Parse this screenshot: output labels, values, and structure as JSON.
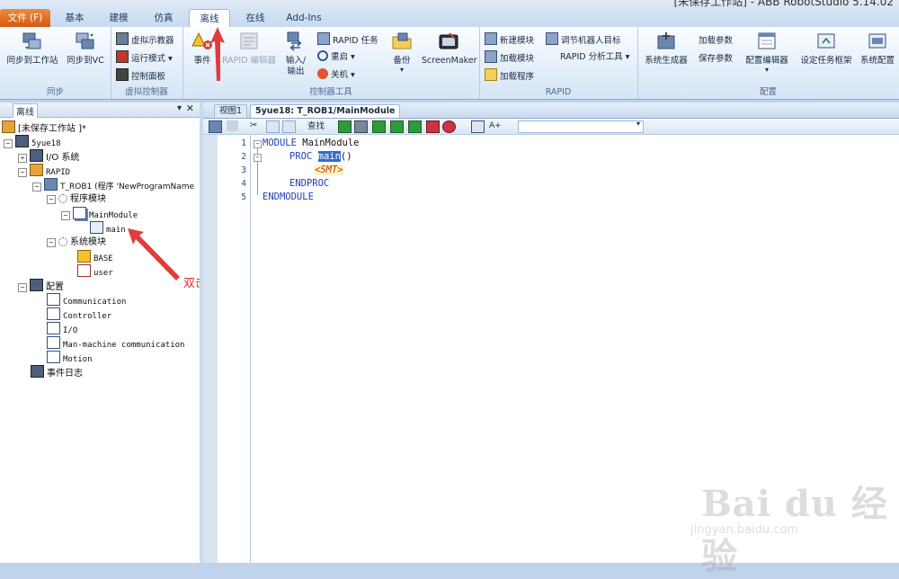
{
  "window": {
    "title": "[未保存工作站] - ABB RobotStudio 5.14.02"
  },
  "tabs": [
    {
      "label": "文件 (F)"
    },
    {
      "label": "基本"
    },
    {
      "label": "建模"
    },
    {
      "label": "仿真"
    },
    {
      "label": "离线"
    },
    {
      "label": "在线"
    },
    {
      "label": "Add-Ins"
    }
  ],
  "ribbon": {
    "sync": {
      "label": "同步",
      "to_station": "同步到工作站",
      "to_vc": "同步到VC"
    },
    "vc": {
      "label": "虚拟控制器",
      "flexpendant": "虚拟示教器",
      "run_mode": "运行模式",
      "control_panel": "控制面板"
    },
    "tools": {
      "label": "控制器工具",
      "events": "事件",
      "rapid_editor": "RAPID 编辑器",
      "io": "输入/\n输出",
      "rapid_tasks": "RAPID 任务",
      "restart": "重启",
      "shutdown": "关机",
      "backup": "备份",
      "screenmaker": "ScreenMaker"
    },
    "rapid": {
      "label": "RAPID",
      "new_module": "新建模块",
      "load_module": "加载模块",
      "load_program": "加载程序",
      "adjust_targets": "调节机器人目标",
      "rapid_analysis": "RAPID 分析工具"
    },
    "config": {
      "label": "配置",
      "system_builder": "系统生成器",
      "load_params": "加载参数",
      "save_params": "保存参数",
      "config_editor": "配置编辑器",
      "task_frame": "设定任务框架",
      "system_config": "系统配置"
    }
  },
  "left_panel": {
    "title": "离线",
    "tree": [
      {
        "label": "[未保存工作站 ]*"
      },
      {
        "label": "5yue18"
      },
      {
        "label": "I/O 系统"
      },
      {
        "label": "RAPID"
      },
      {
        "label": "T_ROB1 (程序 'NewProgramName"
      },
      {
        "label": "程序模块"
      },
      {
        "label": "MainModule"
      },
      {
        "label": "main"
      },
      {
        "label": "系统模块"
      },
      {
        "label": "BASE"
      },
      {
        "label": "user"
      },
      {
        "label": "配置"
      },
      {
        "label": "Communication"
      },
      {
        "label": "Controller"
      },
      {
        "label": "I/O"
      },
      {
        "label": "Man-machine communication"
      },
      {
        "label": "Motion"
      },
      {
        "label": "事件日志"
      }
    ]
  },
  "editor": {
    "tabs": [
      {
        "label": "视图1"
      },
      {
        "label": "5yue18: T_ROB1/MainModule"
      }
    ],
    "find_label": "查找",
    "lines": [
      {
        "num": "1",
        "kw": "MODULE",
        "rest": " MainModule"
      },
      {
        "num": "2",
        "kw": "PROC",
        "sel": "main",
        "rest": "()"
      },
      {
        "num": "3",
        "smt": "<SMT>"
      },
      {
        "num": "4",
        "kw": "ENDPROC"
      },
      {
        "num": "5",
        "kw": "ENDMODULE"
      }
    ]
  },
  "annotation": {
    "text": "双击"
  },
  "watermark": {
    "brand": "Bai du 经验",
    "url": "jingyan.baidu.com"
  },
  "colors": {
    "accent": "#d45a10",
    "keyword": "#1f3fb8",
    "selection": "#2f6fd0",
    "smt": "#c0390a",
    "annotation": "#e03030"
  }
}
